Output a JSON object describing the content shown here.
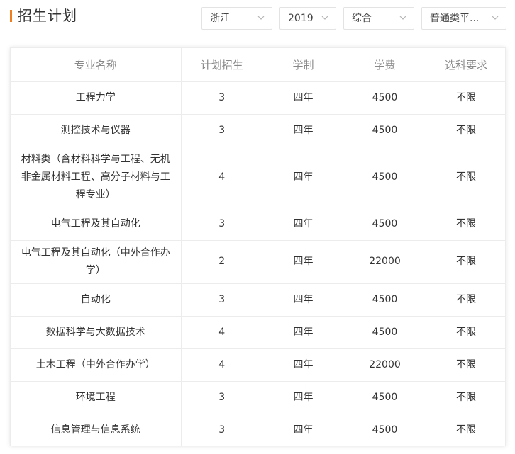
{
  "header": {
    "title": "招生计划",
    "accent_color": "#f07d1e"
  },
  "filters": {
    "province": "浙江",
    "year": "2019",
    "category": "综合",
    "batch": "普通类平..."
  },
  "table": {
    "columns": [
      "专业名称",
      "计划招生",
      "学制",
      "学费",
      "选科要求"
    ],
    "rows": [
      {
        "name": "工程力学",
        "plan": "3",
        "duration": "四年",
        "fee": "4500",
        "req": "不限"
      },
      {
        "name": "测控技术与仪器",
        "plan": "3",
        "duration": "四年",
        "fee": "4500",
        "req": "不限"
      },
      {
        "name": "材料类（含材料科学与工程、无机非金属材料工程、高分子材料与工程专业）",
        "plan": "4",
        "duration": "四年",
        "fee": "4500",
        "req": "不限"
      },
      {
        "name": "电气工程及其自动化",
        "plan": "3",
        "duration": "四年",
        "fee": "4500",
        "req": "不限"
      },
      {
        "name": "电气工程及其自动化（中外合作办学）",
        "plan": "2",
        "duration": "四年",
        "fee": "22000",
        "req": "不限"
      },
      {
        "name": "自动化",
        "plan": "3",
        "duration": "四年",
        "fee": "4500",
        "req": "不限"
      },
      {
        "name": "数据科学与大数据技术",
        "plan": "4",
        "duration": "四年",
        "fee": "4500",
        "req": "不限"
      },
      {
        "name": "土木工程（中外合作办学）",
        "plan": "4",
        "duration": "四年",
        "fee": "22000",
        "req": "不限"
      },
      {
        "name": "环境工程",
        "plan": "3",
        "duration": "四年",
        "fee": "4500",
        "req": "不限"
      },
      {
        "name": "信息管理与信息系统",
        "plan": "3",
        "duration": "四年",
        "fee": "4500",
        "req": "不限"
      }
    ]
  }
}
